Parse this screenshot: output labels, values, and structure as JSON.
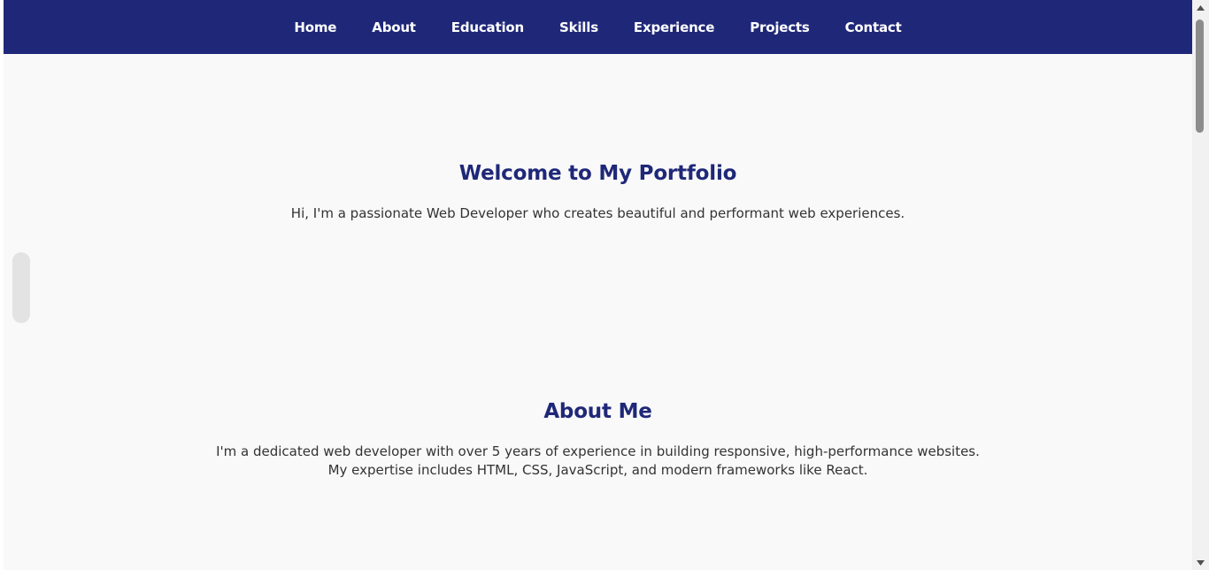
{
  "nav": {
    "items": [
      {
        "label": "Home"
      },
      {
        "label": "About"
      },
      {
        "label": "Education"
      },
      {
        "label": "Skills"
      },
      {
        "label": "Experience"
      },
      {
        "label": "Projects"
      },
      {
        "label": "Contact"
      }
    ]
  },
  "hero": {
    "title": "Welcome to My Portfolio",
    "text": "Hi, I'm a passionate Web Developer who creates beautiful and performant web experiences."
  },
  "about": {
    "title": "About Me",
    "line1": "I'm a dedicated web developer with over 5 years of experience in building responsive, high-performance websites.",
    "line2": "My expertise includes HTML, CSS, JavaScript, and modern frameworks like React."
  },
  "colors": {
    "navbar": "#1f2878",
    "heading": "#1f2878",
    "background": "#f9f9f9"
  },
  "icons": {
    "scroll_up": "triangle-up-icon",
    "scroll_down": "triangle-down-icon"
  }
}
